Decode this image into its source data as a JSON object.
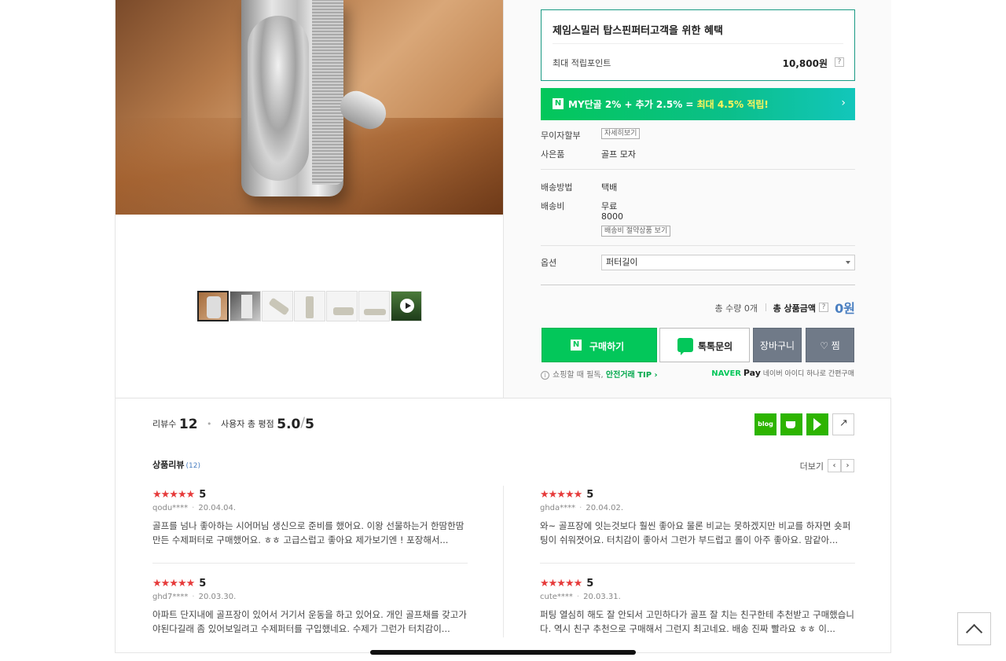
{
  "benefit": {
    "title": "제임스밀러 탑스핀퍼터고객을 위한 혜택",
    "point_label": "최대 적립포인트",
    "point_value": "10,800원",
    "help": "?"
  },
  "naver_banner": {
    "n": "N",
    "prefix": "MY단골 2% + 추가 2.5% = ",
    "highlight": "최대 4.5% 적립!",
    "arrow": "›"
  },
  "info": {
    "installment_label": "무이자할부",
    "installment_btn": "자세히보기",
    "gift_label": "사은품",
    "gift_value": "골프 모자",
    "ship_method_label": "배송방법",
    "ship_method_value": "택배",
    "ship_fee_label": "배송비",
    "ship_fee_value": "무료",
    "ship_fee_extra": "8000",
    "ship_fee_btn": "배송비 절약상품 보기",
    "option_label": "옵션",
    "option_selected": "퍼터길이"
  },
  "total": {
    "qty_text": "총 수량 0개",
    "amount_label": "총 상품금액",
    "amount_value": "0원"
  },
  "buttons": {
    "buy": "구매하기",
    "talk": "톡톡문의",
    "cart": "장바구니",
    "wish": "♡ 찜"
  },
  "tip": {
    "icon": "i",
    "text": "쇼핑할 때 필독, ",
    "link": "안전거래 TIP ›"
  },
  "npay": {
    "brand": "NAVER",
    "pay": "Pay",
    "text": " 네이버 아이디 하나로 간편구매"
  },
  "review_summary": {
    "count_label": "리뷰수",
    "count": "12",
    "rating_label": "사용자 총 평점",
    "rating": "5.0",
    "rating_max": "5"
  },
  "share": {
    "blog": "blog"
  },
  "review_section": {
    "title": "상품리뷰",
    "count": "(12)",
    "more": "더보기",
    "prev": "‹",
    "next": "›"
  },
  "reviews": [
    {
      "stars": "★★★★★",
      "score": "5",
      "user": "qodu****",
      "date": "20.04.04.",
      "body": "골프를 넘나 좋아하는 시어머님 생신으로 준비를 했어요. 이왕 선물하는거 한땀한땀 만든 수제퍼터로 구매했어요. ㅎㅎ 고급스럽고 좋아요 제가보기엔 ! 포장해서..."
    },
    {
      "stars": "★★★★★",
      "score": "5",
      "user": "ghda****",
      "date": "20.04.02.",
      "body": "와~ 골프장에 잇는것보다 훨씬 좋아요 물론 비교는 못하겠지만 비교를 하자면 숏퍼팅이 쉬워졋어요. 터치감이 좋아서 그런가 부드럽고 롤이 아주 좋아요. 맘같아..."
    },
    {
      "stars": "★★★★★",
      "score": "5",
      "user": "ghd7****",
      "date": "20.03.30.",
      "body": "아파트 단지내에 골프장이 있어서 거기서 운동을 하고 있어요. 개인 골프채를 갖고가야된다길래 좀 있어보일려고 수제퍼터를 구입했네요. 수제가 그런가 터치감이..."
    },
    {
      "stars": "★★★★★",
      "score": "5",
      "user": "cute****",
      "date": "20.03.31.",
      "body": "퍼팅 열심히 해도 잘 안되서 고민하다가 골프 잘 치는 친구한테 추천받고 구매했습니다. 역시 친구 추천으로 구매해서 그런지 최고네요. 배송 진짜 빨라요 ㅎㅎ 이..."
    }
  ]
}
